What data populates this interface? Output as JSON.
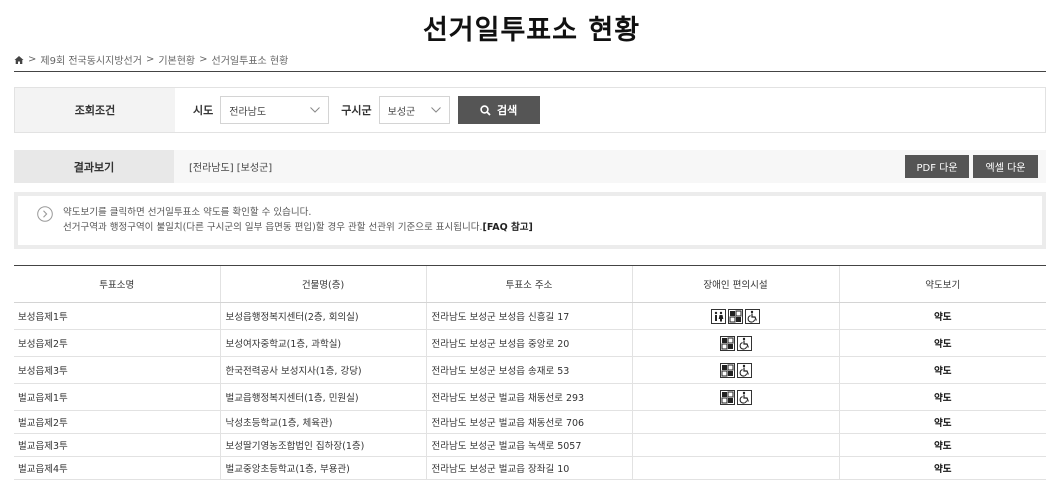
{
  "page": {
    "title": "선거일투표소 현황"
  },
  "breadcrumb": {
    "home_icon": "home-icon",
    "items": [
      "제9회 전국동시지방선거",
      "기본현황",
      "선거일투표소 현황"
    ],
    "separator": ">"
  },
  "search": {
    "label": "조회조건",
    "sido_label": "시도",
    "sido_value": "전라남도",
    "gu_label": "구시군",
    "gu_value": "보성군",
    "button_label": "검색"
  },
  "result": {
    "label": "결과보기",
    "value": "[전라남도] [보성군]",
    "pdf_label": "PDF 다운",
    "excel_label": "엑셀 다운"
  },
  "notice": {
    "line1": "약도보기를 클릭하면 선거일투표소 약도를 확인할 수 있습니다.",
    "line2": "선거구역과 행정구역이 불일치(다른 구시군의 일부 읍면동 편입)할 경우 관할 선관위 기준으로 표시됩니다.",
    "faq": "[FAQ 참고]"
  },
  "table": {
    "headers": [
      "투표소명",
      "건물명(층)",
      "투표소 주소",
      "장애인 편의시설",
      "약도보기"
    ],
    "rows": [
      {
        "name": "보성읍제1투",
        "building": "보성읍행정복지센터(2층, 회의실)",
        "address": "전라남도 보성군 보성읍 신흥길 17",
        "facilities": [
          "toilet-icon",
          "braille-icon",
          "wheelchair-icon"
        ],
        "map": "약도"
      },
      {
        "name": "보성읍제2투",
        "building": "보성여자중학교(1층, 과학실)",
        "address": "전라남도 보성군 보성읍 중앙로 20",
        "facilities": [
          "braille-icon",
          "wheelchair-icon"
        ],
        "map": "약도"
      },
      {
        "name": "보성읍제3투",
        "building": "한국전력공사 보성지사(1층, 강당)",
        "address": "전라남도 보성군 보성읍 송재로 53",
        "facilities": [
          "braille-icon",
          "wheelchair-icon"
        ],
        "map": "약도"
      },
      {
        "name": "벌교읍제1투",
        "building": "벌교읍행정복지센터(1층, 민원실)",
        "address": "전라남도 보성군 벌교읍 채동선로 293",
        "facilities": [
          "braille-icon",
          "wheelchair-icon"
        ],
        "map": "약도"
      },
      {
        "name": "벌교읍제2투",
        "building": "낙성초등학교(1층, 체육관)",
        "address": "전라남도 보성군 벌교읍 채동선로 706",
        "facilities": [],
        "map": "약도"
      },
      {
        "name": "벌교읍제3투",
        "building": "보성딸기영농조합법인 집하장(1층)",
        "address": "전라남도 보성군 벌교읍 녹색로 5057",
        "facilities": [],
        "map": "약도"
      },
      {
        "name": "벌교읍제4투",
        "building": "벌교중앙초등학교(1층, 부용관)",
        "address": "전라남도 보성군 벌교읍 장좌길 10",
        "facilities": [],
        "map": "약도"
      }
    ]
  }
}
